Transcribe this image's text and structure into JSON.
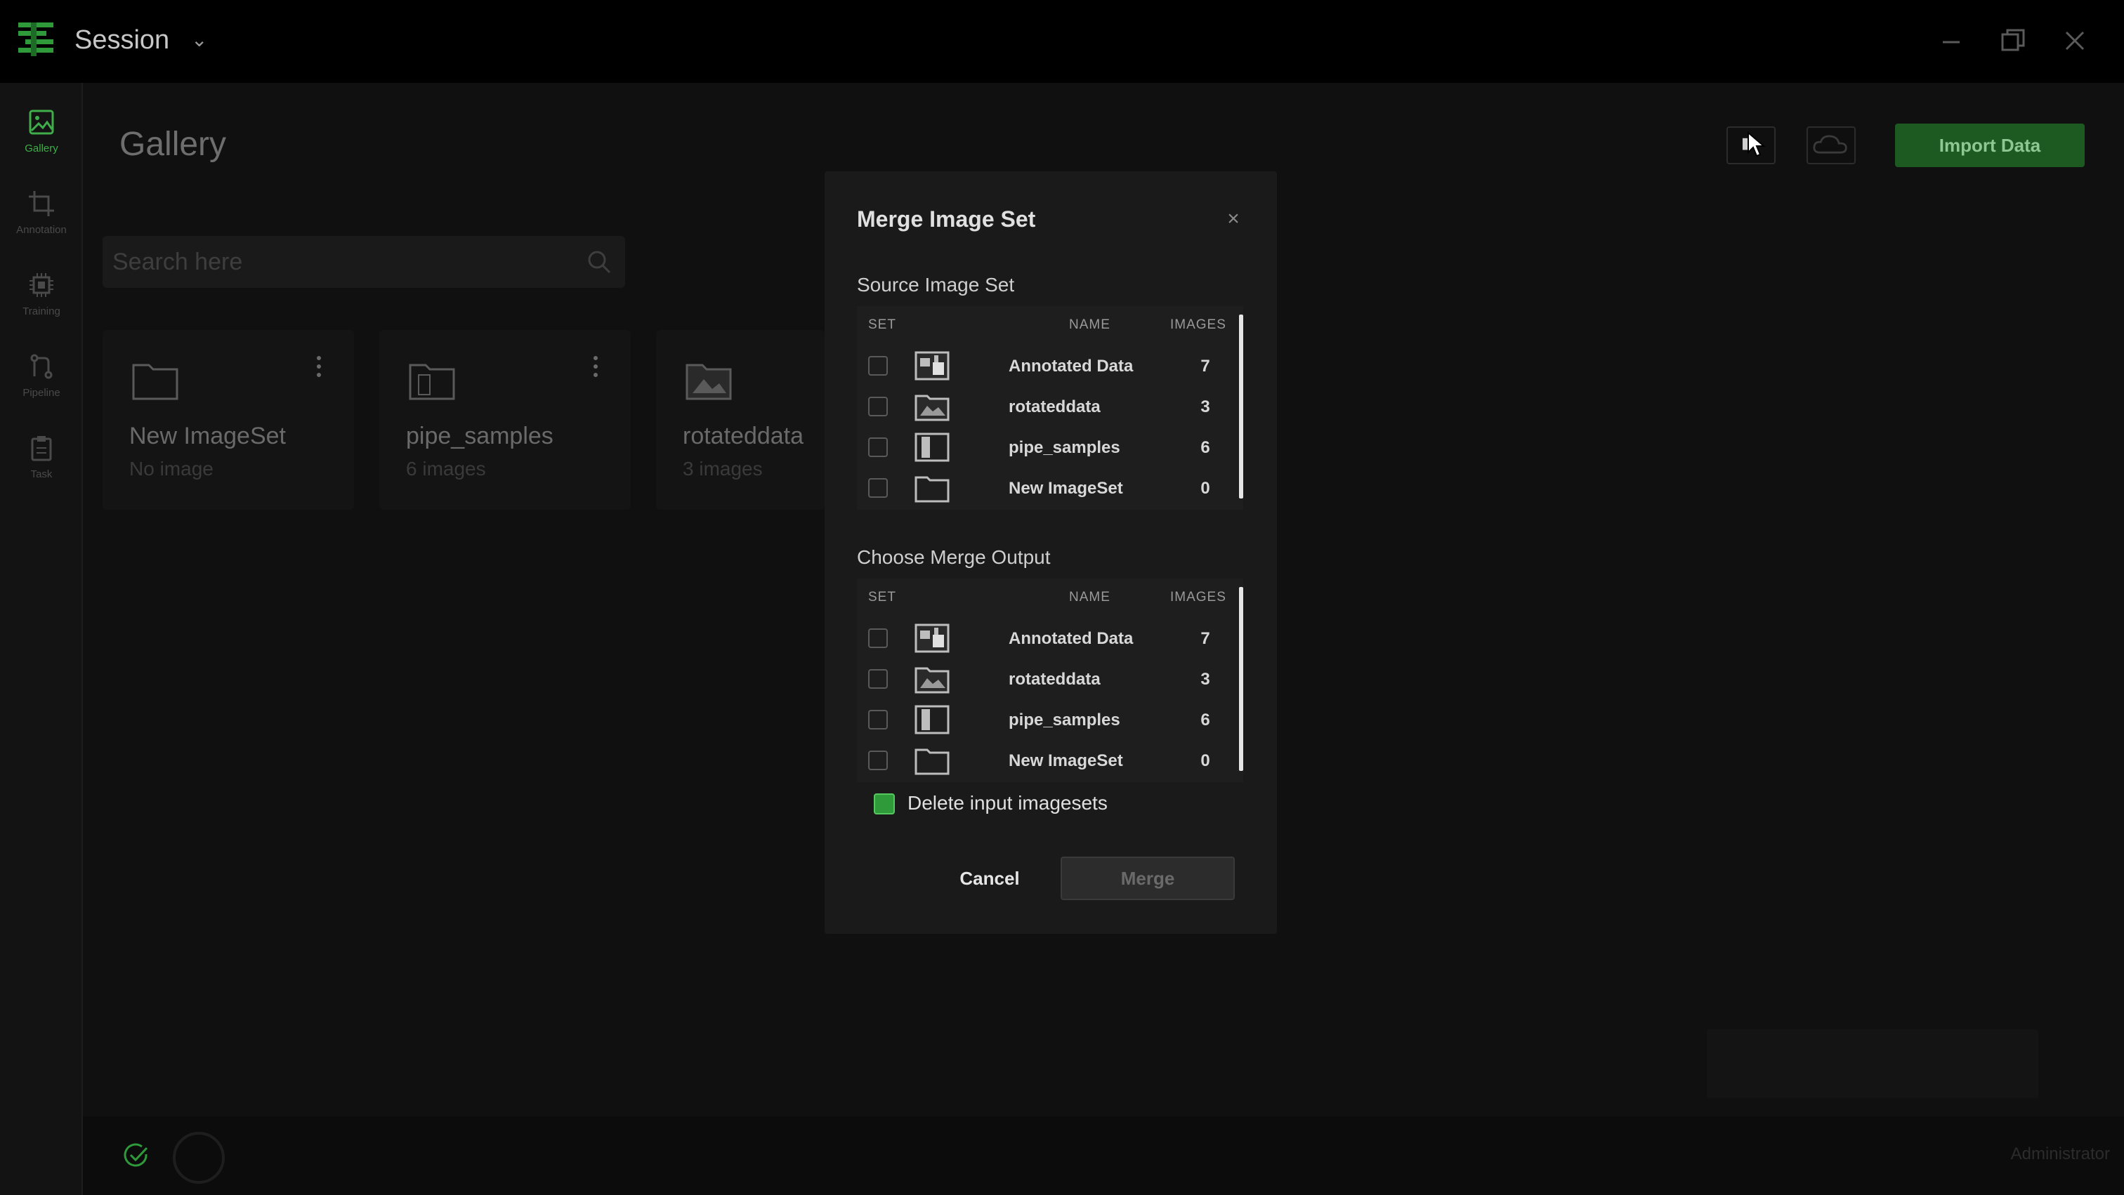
{
  "app": {
    "session_title": "Session"
  },
  "sidebar": {
    "items": [
      {
        "label": "Gallery",
        "icon": "image-icon",
        "active": true
      },
      {
        "label": "Annotation",
        "icon": "crop-icon",
        "active": false
      },
      {
        "label": "Training",
        "icon": "chip-icon",
        "active": false
      },
      {
        "label": "Pipeline",
        "icon": "pipeline-icon",
        "active": false
      },
      {
        "label": "Task",
        "icon": "clipboard-icon",
        "active": false
      }
    ]
  },
  "gallery": {
    "title": "Gallery",
    "search_placeholder": "Search here",
    "import_label": "Import Data",
    "cards": [
      {
        "name": "New ImageSet",
        "count": "No image"
      },
      {
        "name": "pipe_samples",
        "count": "6 images"
      },
      {
        "name": "rotateddata",
        "count": "3 images"
      }
    ]
  },
  "modal": {
    "title": "Merge Image Set",
    "close_label": "×",
    "source_label": "Source Image Set",
    "output_label": "Choose Merge Output",
    "headers": {
      "set": "SET",
      "name": "NAME",
      "images": "IMAGES"
    },
    "sets": [
      {
        "name": "Annotated Data",
        "images": "7",
        "icon": "annotated-folder-icon"
      },
      {
        "name": "rotateddata",
        "images": "3",
        "icon": "image-folder-icon"
      },
      {
        "name": "pipe_samples",
        "images": "6",
        "icon": "document-folder-icon"
      },
      {
        "name": "New ImageSet",
        "images": "0",
        "icon": "empty-folder-icon"
      }
    ],
    "delete_label": "Delete input imagesets",
    "delete_checked": true,
    "cancel_label": "Cancel",
    "merge_label": "Merge"
  },
  "footer": {
    "user": "Administrator"
  },
  "colors": {
    "accent": "#2f9a3a",
    "import_bg": "#1d5a22"
  }
}
